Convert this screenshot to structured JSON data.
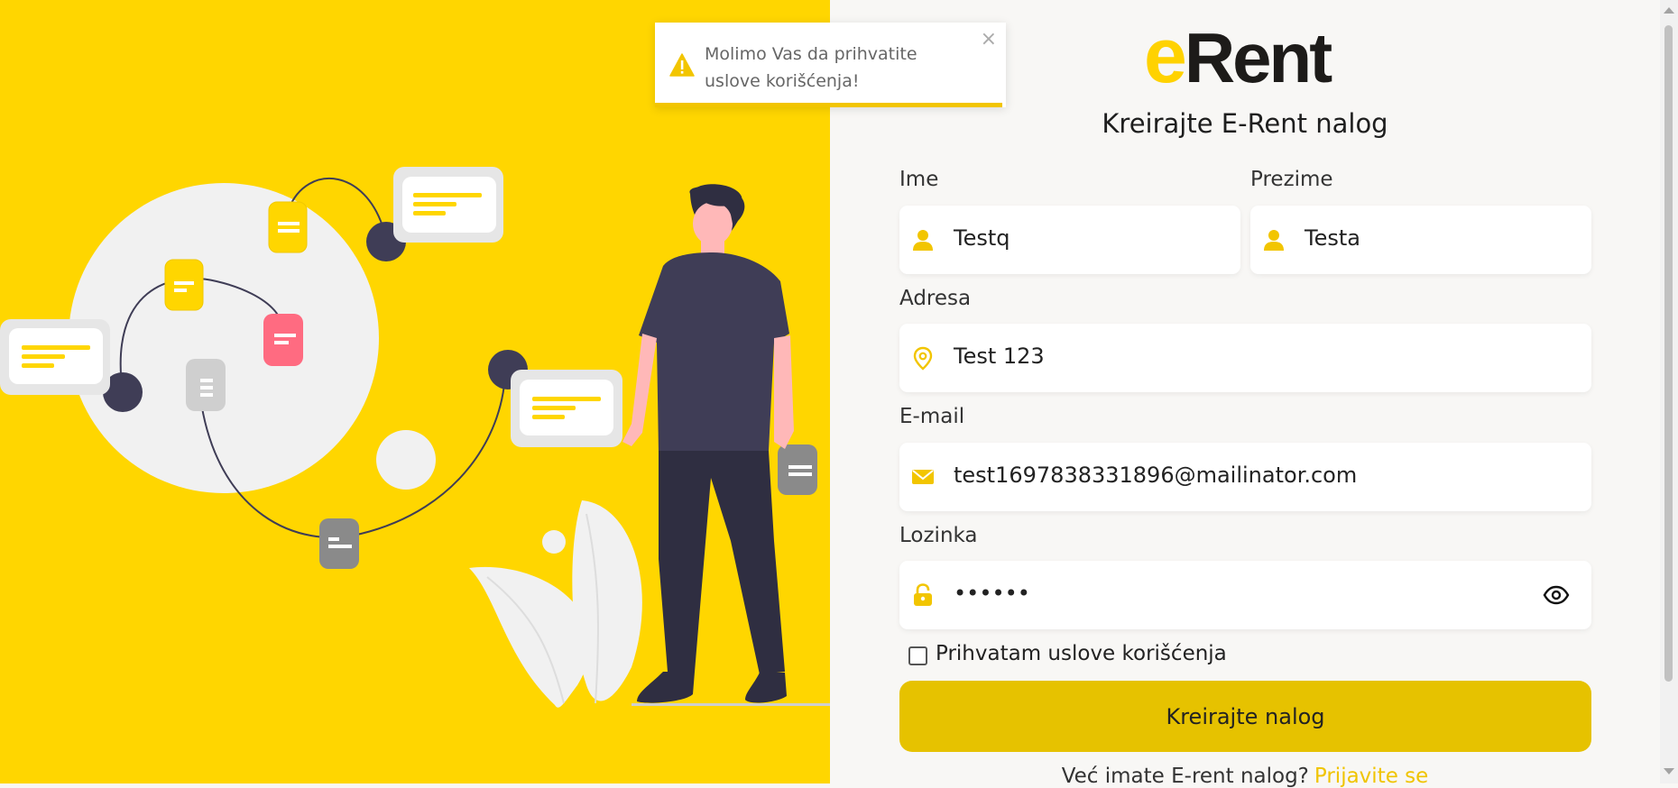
{
  "brand": {
    "logo_e": "e",
    "logo_rest": "Rent",
    "accent_color": "#ffd600",
    "button_color": "#e6c200"
  },
  "page": {
    "title": "Kreirajte E-Rent nalog"
  },
  "form": {
    "first_name": {
      "label": "Ime",
      "value": "Testq",
      "icon": "user-icon"
    },
    "last_name": {
      "label": "Prezime",
      "value": "Testa",
      "icon": "user-icon"
    },
    "address": {
      "label": "Adresa",
      "value": "Test 123",
      "icon": "location-pin-icon"
    },
    "email": {
      "label": "E-mail",
      "value": "test1697838331896@mailinator.com",
      "icon": "envelope-icon"
    },
    "password": {
      "label": "Lozinka",
      "value": "••••••",
      "icon": "lock-icon",
      "toggle_icon": "eye-icon"
    },
    "terms": {
      "label": "Prihvatam uslove korišćenja",
      "checked": false
    },
    "submit_label": "Kreirajte nalog"
  },
  "footer": {
    "text": "Već imate E-rent nalog?",
    "link": "Prijavite se"
  },
  "toast": {
    "message": "Molimo Vas da prihvatite uslove korišćenja!",
    "icon": "warning-icon",
    "close": "×",
    "progress": 0.99
  }
}
